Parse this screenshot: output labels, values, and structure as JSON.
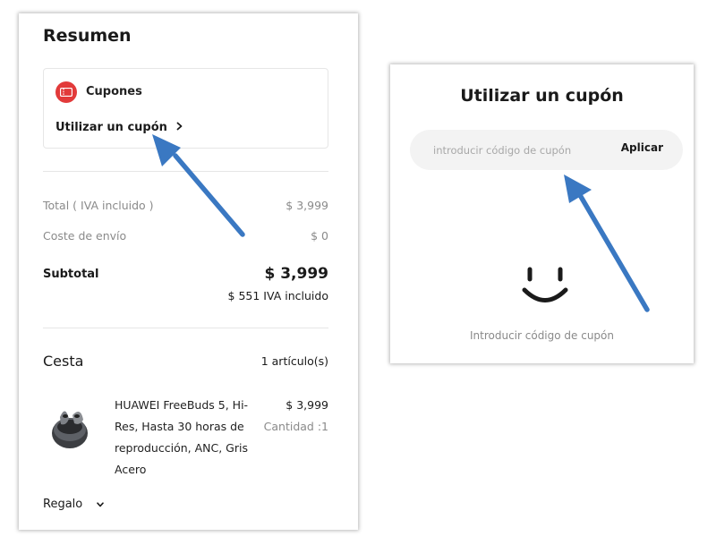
{
  "summary": {
    "title": "Resumen",
    "coupons": {
      "title": "Cupones",
      "use_link": "Utilizar un cupón"
    },
    "rows": [
      {
        "label": "Total ( IVA incluido )",
        "value": "$ 3,999"
      },
      {
        "label": "Coste de envío",
        "value": "$ 0"
      }
    ],
    "subtotal": {
      "label": "Subtotal",
      "value": "$ 3,999",
      "iva_note": "$ 551 IVA incluido"
    }
  },
  "cart": {
    "title": "Cesta",
    "count": "1 artículo(s)",
    "items": [
      {
        "name": "HUAWEI FreeBuds 5, Hi-Res, Hasta 30 horas de reproducción, ANC, Gris Acero",
        "price": "$ 3,999",
        "quantity": "Cantidad :1"
      }
    ],
    "gift_label": "Regalo"
  },
  "coupon_dialog": {
    "title": "Utilizar un cupón",
    "input_placeholder": "introducir código de cupón",
    "input_value": "",
    "apply_label": "Aplicar",
    "empty_hint": "Introducir código de cupón"
  },
  "colors": {
    "coupon_icon": "#e23a3a",
    "annotation_arrow": "#3a78c2"
  },
  "icons": {
    "coupon": "ticket-icon",
    "link_chevron": "chevron-right-icon",
    "gift_chevron": "chevron-down-icon",
    "empty_state": "smiley-icon"
  }
}
